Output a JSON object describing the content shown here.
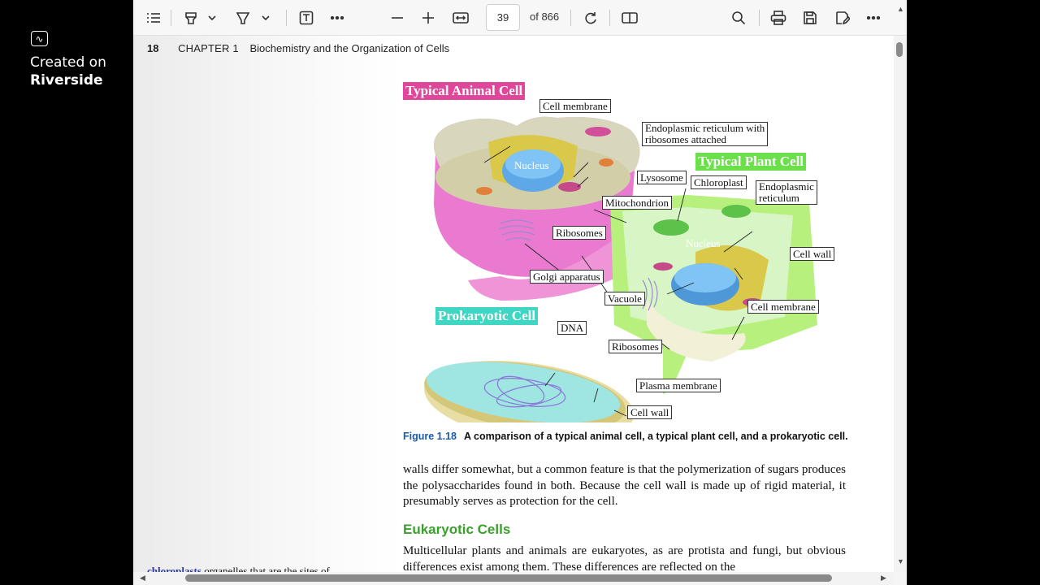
{
  "overlay": {
    "line1": "Created on",
    "line2": "Riverside",
    "logo_glyph": "∿"
  },
  "toolbar": {
    "page_current": "39",
    "page_total": "of 866",
    "icons": [
      "contents-icon",
      "highlight-icon",
      "chevron-down-icon",
      "draw-icon",
      "chevron-down-icon",
      "text-box-icon",
      "more-tools-icon",
      "zoom-out-icon",
      "zoom-in-icon",
      "fit-width-icon",
      "rotate-icon",
      "two-page-icon",
      "search-icon",
      "print-icon",
      "save-icon",
      "save-as-icon",
      "more-icon"
    ]
  },
  "page": {
    "number": "18",
    "chapter": "CHAPTER 1",
    "chapter_title": "Biochemistry and the Organization of Cells"
  },
  "figure": {
    "title_animal": "Typical Animal Cell",
    "title_plant": "Typical Plant Cell",
    "title_prokaryotic": "Prokaryotic Cell",
    "nucleus_animal": "Nucleus",
    "nucleus_plant": "Nucleus",
    "labels": {
      "cell_membrane_animal": "Cell membrane",
      "er_line1": "Endoplasmic reticulum with",
      "er_line2": "ribosomes attached",
      "lysosome": "Lysosome",
      "chloroplast": "Chloroplast",
      "er_plant_line1": "Endoplasmic",
      "er_plant_line2": "reticulum",
      "mitochondrion": "Mitochondrion",
      "ribosomes_animal": "Ribosomes",
      "cell_wall_plant": "Cell wall",
      "golgi": "Golgi apparatus",
      "vacuole": "Vacuole",
      "cell_membrane_plant": "Cell membrane",
      "dna": "DNA",
      "ribosomes_prok": "Ribosomes",
      "plasma_membrane": "Plasma membrane",
      "cell_wall_prok": "Cell wall"
    },
    "caption_number": "Figure 1.18",
    "caption_text": "A comparison of a typical animal cell, a typical plant cell, and a prokaryotic cell."
  },
  "text": {
    "para1": "walls differ somewhat, but a common feature is that the polymerization of sugars produces the polysaccharides found in both. Because the cell wall is made up of rigid material, it presumably serves as protection for the cell.",
    "heading": "Eukaryotic Cells",
    "para2": "Multicellular plants and animals are eukaryotes, as are protista and fungi, but obvious differences exist among them. These differences are reflected on the",
    "margin_term": "chloroplasts",
    "margin_text": " organelles that are the sites of"
  },
  "colors": {
    "animal_title_bg": "#e0479a",
    "plant_title_bg": "#6be04a",
    "prok_title_bg": "#3fd6c4",
    "heading_green": "#3aa02c",
    "figure_blue": "#1a5aa8"
  }
}
